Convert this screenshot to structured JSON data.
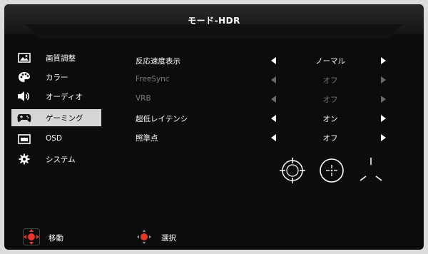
{
  "title": "モード-HDR",
  "sidebar": {
    "items": [
      {
        "label": "画質調整",
        "icon": "picture-icon"
      },
      {
        "label": "カラー",
        "icon": "palette-icon"
      },
      {
        "label": "オーディオ",
        "icon": "speaker-icon"
      },
      {
        "label": "ゲーミング",
        "icon": "gamepad-icon",
        "active": true
      },
      {
        "label": "OSD",
        "icon": "osd-window-icon"
      },
      {
        "label": "システム",
        "icon": "gear-icon"
      }
    ]
  },
  "settings": [
    {
      "label": "反応速度表示",
      "value": "ノーマル",
      "enabled": true
    },
    {
      "label": "FreeSync",
      "value": "オフ",
      "enabled": false
    },
    {
      "label": "VRB",
      "value": "オフ",
      "enabled": false
    },
    {
      "label": "超低レイテンシ",
      "value": "オン",
      "enabled": true
    },
    {
      "label": "照準点",
      "value": "オフ",
      "enabled": true
    }
  ],
  "crosshair_options": [
    "crosshair-circle-icon",
    "crosshair-dot-icon",
    "crosshair-tri-icon"
  ],
  "footer": {
    "move_label": "移動",
    "select_label": "選択"
  },
  "colors": {
    "background": "#0c0c0c",
    "active_item": "#d6d6d6",
    "disabled_text": "#7a7a7a",
    "pad_red": "#e8352a"
  }
}
